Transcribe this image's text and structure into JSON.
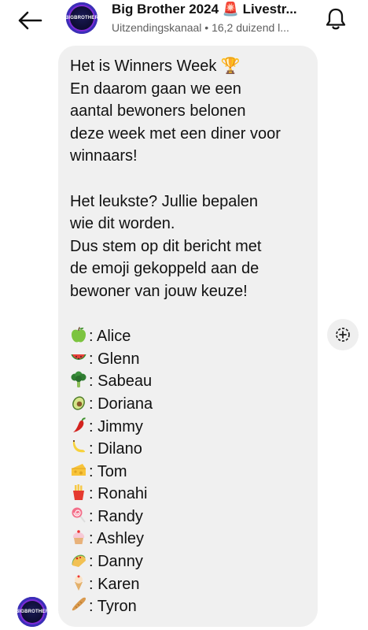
{
  "header": {
    "back_icon": "arrow-left-icon",
    "avatar_logo_text": "BIGBROTHER",
    "title": "Big Brother 2024 🚨 Livestr...",
    "subtitle": "Uitzendingskanaal • 16,2 duizend l...",
    "bell_icon": "bell-icon"
  },
  "message": {
    "intro": [
      "Het is Winners Week 🏆",
      "En daarom gaan we een",
      "aantal bewoners belonen",
      "deze week met een diner voor",
      "winnaars!",
      "",
      "Het leukste? Jullie bepalen",
      "wie dit worden.",
      "Dus stem op dit bericht met",
      "de emoji gekoppeld aan de",
      "bewoner van jouw keuze!",
      ""
    ],
    "votes": [
      {
        "emoji": "green-apple",
        "name": ": Alice"
      },
      {
        "emoji": "watermelon",
        "name": ": Glenn"
      },
      {
        "emoji": "broccoli",
        "name": ": Sabeau"
      },
      {
        "emoji": "avocado",
        "name": ": Doriana"
      },
      {
        "emoji": "hot-pepper",
        "name": ": Jimmy"
      },
      {
        "emoji": "banana",
        "name": ": Dilano"
      },
      {
        "emoji": "cheese",
        "name": ": Tom"
      },
      {
        "emoji": "french-fries",
        "name": ": Ronahi"
      },
      {
        "emoji": "lollipop",
        "name": ": Randy"
      },
      {
        "emoji": "cupcake",
        "name": ": Ashley"
      },
      {
        "emoji": "taco",
        "name": ": Danny"
      },
      {
        "emoji": "ice-cream",
        "name": ": Karen"
      },
      {
        "emoji": "baguette",
        "name": ": Tyron"
      }
    ]
  },
  "react_icon": "add-reaction-icon",
  "colors": {
    "bubble": "#f0f0f0",
    "text": "#111111",
    "subtitle": "#5f5f5f",
    "avatar_ring": "#7d2ad6"
  }
}
